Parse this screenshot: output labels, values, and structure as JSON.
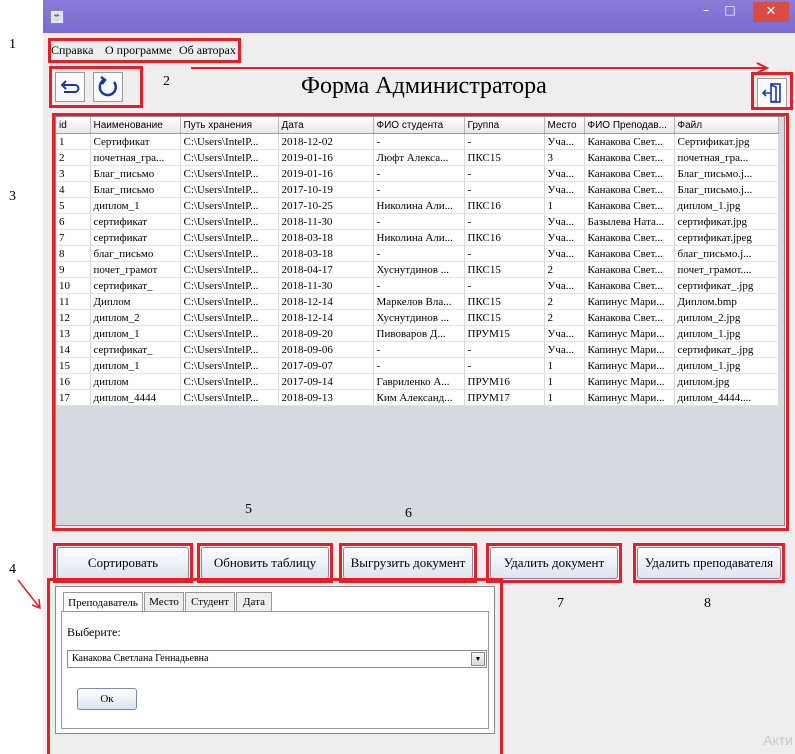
{
  "annotations": [
    "1",
    "2",
    "3",
    "4",
    "5",
    "6",
    "7",
    "8"
  ],
  "window": {
    "close_symbol": "✕",
    "min_symbol": "–",
    "max_symbol": "□",
    "icon": "java-app-icon"
  },
  "menu": [
    "Справка",
    "О программе",
    "Об авторах"
  ],
  "form_title": "Форма Администратора",
  "icons": {
    "back": "back-arrow-icon",
    "refresh": "refresh-icon",
    "exit": "exit-door-icon"
  },
  "table": {
    "columns": [
      "id",
      "Наименование",
      "Путь хранения",
      "Дата",
      "ФИО студента",
      "Группа",
      "Место",
      "ФИО Преподав...",
      "Файл"
    ],
    "rows": [
      [
        "1",
        "Сертификат",
        "C:\\Users\\IntelP...",
        "2018-12-02",
        "-",
        "-",
        "Уча...",
        "Канакова Свет...",
        "Сертификат.jpg"
      ],
      [
        "2",
        "почетная_гра...",
        "C:\\Users\\IntelP...",
        "2019-01-16",
        "Люфт Алекса...",
        "ПКС15",
        "3",
        "Канакова Свет...",
        "почетная_гра..."
      ],
      [
        "3",
        "Благ_письмо",
        "C:\\Users\\IntelP...",
        "2019-01-16",
        "-",
        "-",
        "Уча...",
        "Канакова Свет...",
        "Благ_письмо.j..."
      ],
      [
        "4",
        "Благ_письмо",
        "C:\\Users\\IntelP...",
        "2017-10-19",
        "-",
        "-",
        "Уча...",
        "Канакова Свет...",
        "Благ_письмо.j..."
      ],
      [
        "5",
        "диплом_1",
        "C:\\Users\\IntelP...",
        "2017-10-25",
        "Николина Али...",
        "ПКС16",
        "1",
        "Канакова Свет...",
        "диплом_1.jpg"
      ],
      [
        "6",
        "сертификат",
        "C:\\Users\\IntelP...",
        "2018-11-30",
        "-",
        "-",
        "Уча...",
        "Базылева Ната...",
        "сертификат.jpg"
      ],
      [
        "7",
        "сертификат",
        "C:\\Users\\IntelP...",
        "2018-03-18",
        "Николина Али...",
        "ПКС16",
        "Уча...",
        "Канакова Свет...",
        "сертификат.jpeg"
      ],
      [
        "8",
        "благ_письмо",
        "C:\\Users\\IntelP...",
        "2018-03-18",
        "-",
        "-",
        "Уча...",
        "Канакова Свет...",
        "благ_письмо.j..."
      ],
      [
        "9",
        "почет_грамот",
        "C:\\Users\\IntelP...",
        "2018-04-17",
        "Хуснутдинов ...",
        "ПКС15",
        "2",
        "Канакова Свет...",
        "почет_грамот...."
      ],
      [
        "10",
        "сертификат_",
        "C:\\Users\\IntelP...",
        "2018-11-30",
        "-",
        "-",
        "Уча...",
        "Канакова Свет...",
        "сертификат_.jpg"
      ],
      [
        "11",
        "Диплом",
        "C:\\Users\\IntelP...",
        "2018-12-14",
        "Маркелов Вла...",
        "ПКС15",
        "2",
        "Капинус Мари...",
        "Диплом.bmp"
      ],
      [
        "12",
        "диплом_2",
        "C:\\Users\\IntelP...",
        "2018-12-14",
        "Хуснутдинов ...",
        "ПКС15",
        "2",
        "Канакова Свет...",
        "диплом_2.jpg"
      ],
      [
        "13",
        "диплом_1",
        "C:\\Users\\IntelP...",
        "2018-09-20",
        "Пивоваров Д...",
        "ПРУМ15",
        "Уча...",
        "Капинус Мари...",
        "диплом_1.jpg"
      ],
      [
        "14",
        "сертификат_",
        "C:\\Users\\IntelP...",
        "2018-09-06",
        "-",
        "-",
        "Уча...",
        "Капинус Мари...",
        "сертификат_.jpg"
      ],
      [
        "15",
        "диплом_1",
        "C:\\Users\\IntelP...",
        "2017-09-07",
        "-",
        "-",
        "1",
        "Капинус Мари...",
        "диплом_1.jpg"
      ],
      [
        "16",
        "диплом",
        "C:\\Users\\IntelP...",
        "2017-09-14",
        "Гавриленко А...",
        "ПРУМ16",
        "1",
        "Капинус Мари...",
        "диплом.jpg"
      ],
      [
        "17",
        "диплом_4444",
        "C:\\Users\\IntelP...",
        "2018-09-13",
        "Ким Александ...",
        "ПРУМ17",
        "1",
        "Капинус Мари...",
        "диплом_4444...."
      ]
    ]
  },
  "buttons": {
    "sort": "Сортировать",
    "refresh_table": "Обновить таблицу",
    "export_doc": "Выгрузить документ",
    "delete_doc": "Удалить документ",
    "delete_teacher": "Удалить преподавателя"
  },
  "panel": {
    "tabs": [
      "Преподаватель",
      "Место",
      "Студент",
      "Дата"
    ],
    "select_label": "Выберите:",
    "selected_value": "Канакова Светлана Геннадьевна",
    "ok": "Ок"
  },
  "watermark": "Акти",
  "colors": {
    "titlebar": "#7b6bd0",
    "close": "#d84c43",
    "highlight": "#e3202a",
    "window_bg": "#eeeeee"
  }
}
